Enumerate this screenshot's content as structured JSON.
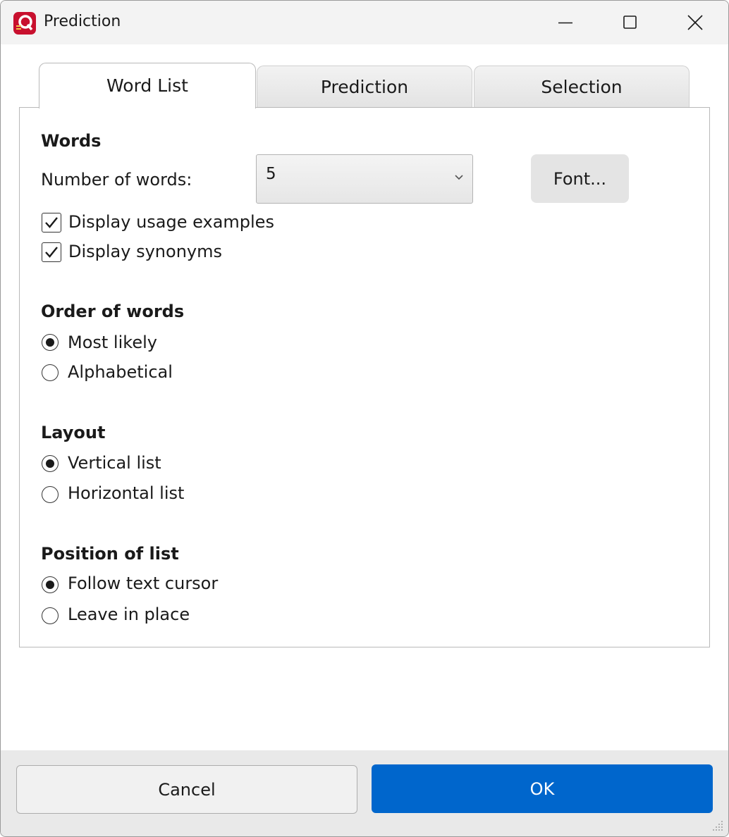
{
  "window": {
    "title": "Prediction",
    "icon": "app-logo-icon",
    "controls": [
      "minimize-icon",
      "maximize-icon",
      "close-icon"
    ]
  },
  "tabs": [
    {
      "label": "Word List",
      "active": true
    },
    {
      "label": "Prediction",
      "active": false
    },
    {
      "label": "Selection",
      "active": false
    }
  ],
  "words": {
    "heading": "Words",
    "number_label": "Number of words:",
    "number_value": "5",
    "font_button": "Font...",
    "usage_examples_label": "Display usage examples",
    "usage_examples_checked": true,
    "synonyms_label": "Display synonyms",
    "synonyms_checked": true
  },
  "order": {
    "heading": "Order of words",
    "options": [
      "Most likely",
      "Alphabetical"
    ],
    "selected": "Most likely"
  },
  "layout": {
    "heading": "Layout",
    "options": [
      "Vertical list",
      "Horizontal list"
    ],
    "selected": "Vertical list"
  },
  "position": {
    "heading": "Position of list",
    "options": [
      "Follow text cursor",
      "Leave in place"
    ],
    "selected": "Follow text cursor"
  },
  "footer": {
    "cancel_label": "Cancel",
    "ok_label": "OK"
  },
  "colors": {
    "accent": "#0066cc",
    "logo": "#c8102e"
  }
}
